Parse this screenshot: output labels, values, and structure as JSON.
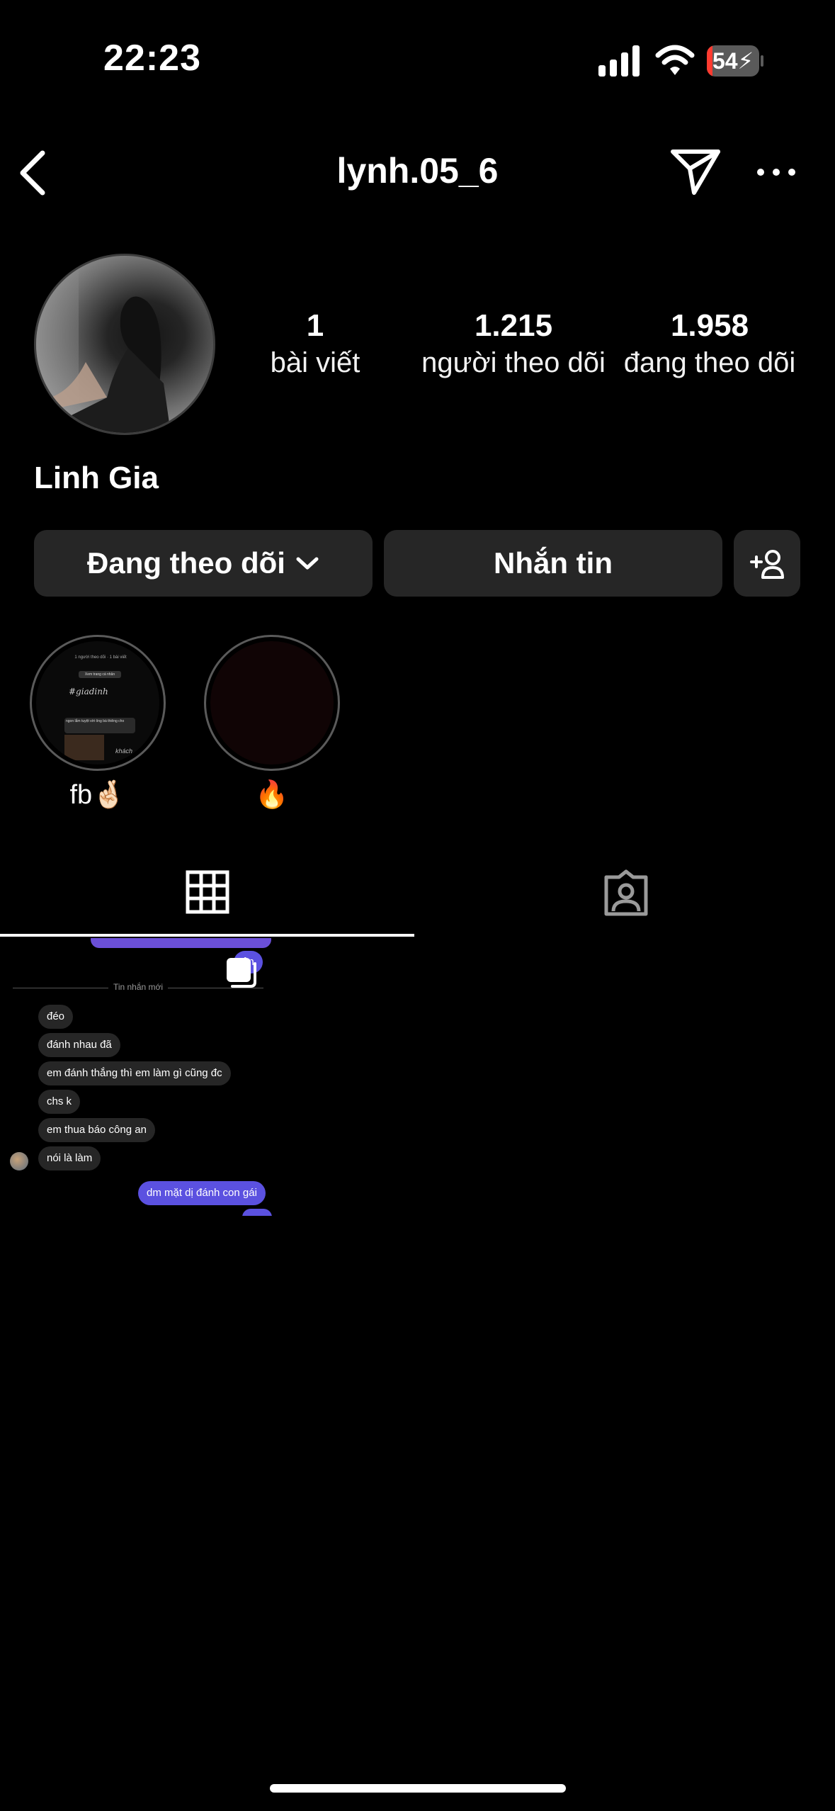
{
  "status_bar": {
    "time": "22:23",
    "battery": "54"
  },
  "header": {
    "username": "lynh.05_6"
  },
  "profile": {
    "display_name": "Linh Gia",
    "stats": [
      {
        "value": "1",
        "label": "bài viết"
      },
      {
        "value": "1.215",
        "label": "người theo dõi"
      },
      {
        "value": "1.958",
        "label": "đang theo dõi"
      }
    ]
  },
  "actions": {
    "following_label": "Đang theo dõi",
    "message_label": "Nhắn tin"
  },
  "highlights": [
    {
      "label": "fb🤞🏻"
    },
    {
      "label": "🔥"
    }
  ],
  "highlight_preview": {
    "line1": "1 người theo dõi · 1 bài viết",
    "line2": "Xem trang cá nhân",
    "line3": "#giadinh",
    "line4": "ngon lắm tuyệt vời ông bà thiêng cho",
    "line5": "khách"
  },
  "post_preview": {
    "divider_label": "Tin nhắn mới",
    "top_right_bubble": "ên",
    "messages_left": [
      "đéo",
      "đánh nhau đã",
      "em đánh thắng thì em làm gì cũng đc",
      "chs k",
      "em thua báo công an",
      "nói là làm"
    ],
    "message_right": "dm mặt dị đánh con gái"
  },
  "colors": {
    "background": "#000000",
    "button_bg": "#262626",
    "accent_purple": "#5b51e0",
    "text": "#ffffff"
  },
  "icons": [
    "back-icon",
    "send-icon",
    "more-icon",
    "chevron-down-icon",
    "add-person-icon",
    "grid-icon",
    "tagged-icon",
    "multi-photo-icon"
  ]
}
